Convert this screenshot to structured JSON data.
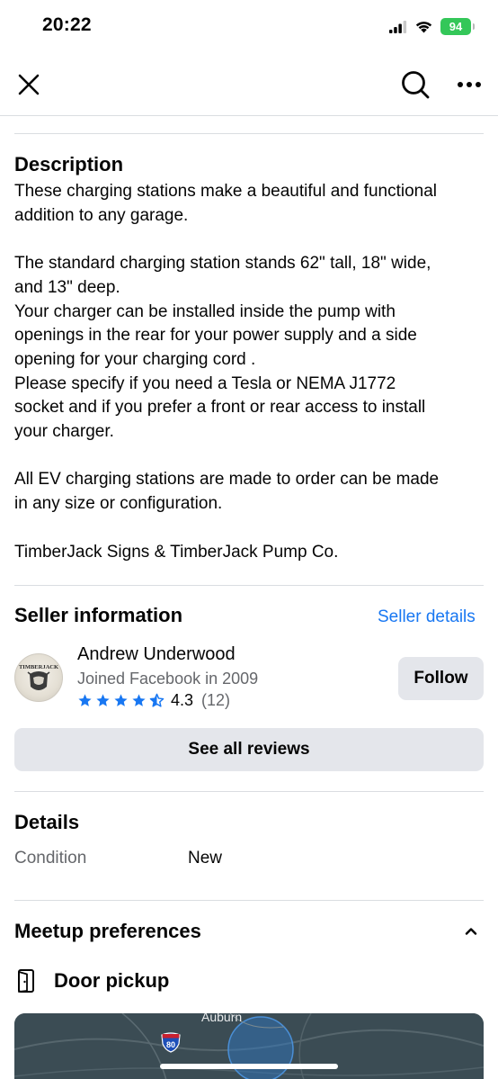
{
  "status_bar": {
    "time": "20:22",
    "battery": "94",
    "icons": [
      "signal-icon",
      "wifi-icon",
      "battery-icon"
    ]
  },
  "nav": {
    "icons": [
      "close-icon",
      "search-icon",
      "more-icon"
    ]
  },
  "description": {
    "heading": "Description",
    "body": "These charging stations make a beautiful and functional\naddition to any garage.\n\nThe standard charging station stands 62\" tall, 18\" wide,\nand 13\" deep.\nYour charger can be installed inside the pump with\nopenings in the rear for your power supply and a side\nopening for your charging cord .\nPlease specify if you need a Tesla  or  NEMA J1772\nsocket and if you prefer a front or rear access to install\nyour charger.\n\nAll EV charging stations are made to order can be made\nin any size or configuration.\n\nTimberJack Signs & TimberJack Pump Co."
  },
  "seller": {
    "heading": "Seller information",
    "details_link": "Seller details",
    "avatar_text": "TIMBERJACK",
    "name": "Andrew Underwood",
    "joined": "Joined Facebook in 2009",
    "rating": 4.3,
    "rating_label": "4.3",
    "review_count": "(12)",
    "follow_label": "Follow",
    "reviews_button": "See all reviews"
  },
  "details": {
    "heading": "Details",
    "condition_label": "Condition",
    "condition_value": "New"
  },
  "meetup": {
    "heading": "Meetup preferences",
    "pickup_label": "Door pickup",
    "map_label": "Auburn",
    "interstate": "80"
  },
  "colors": {
    "accent": "#1877f2",
    "button_bg": "#e4e6eb",
    "secondary_text": "#65676b",
    "divider": "#dadde1",
    "battery": "#34c759"
  }
}
